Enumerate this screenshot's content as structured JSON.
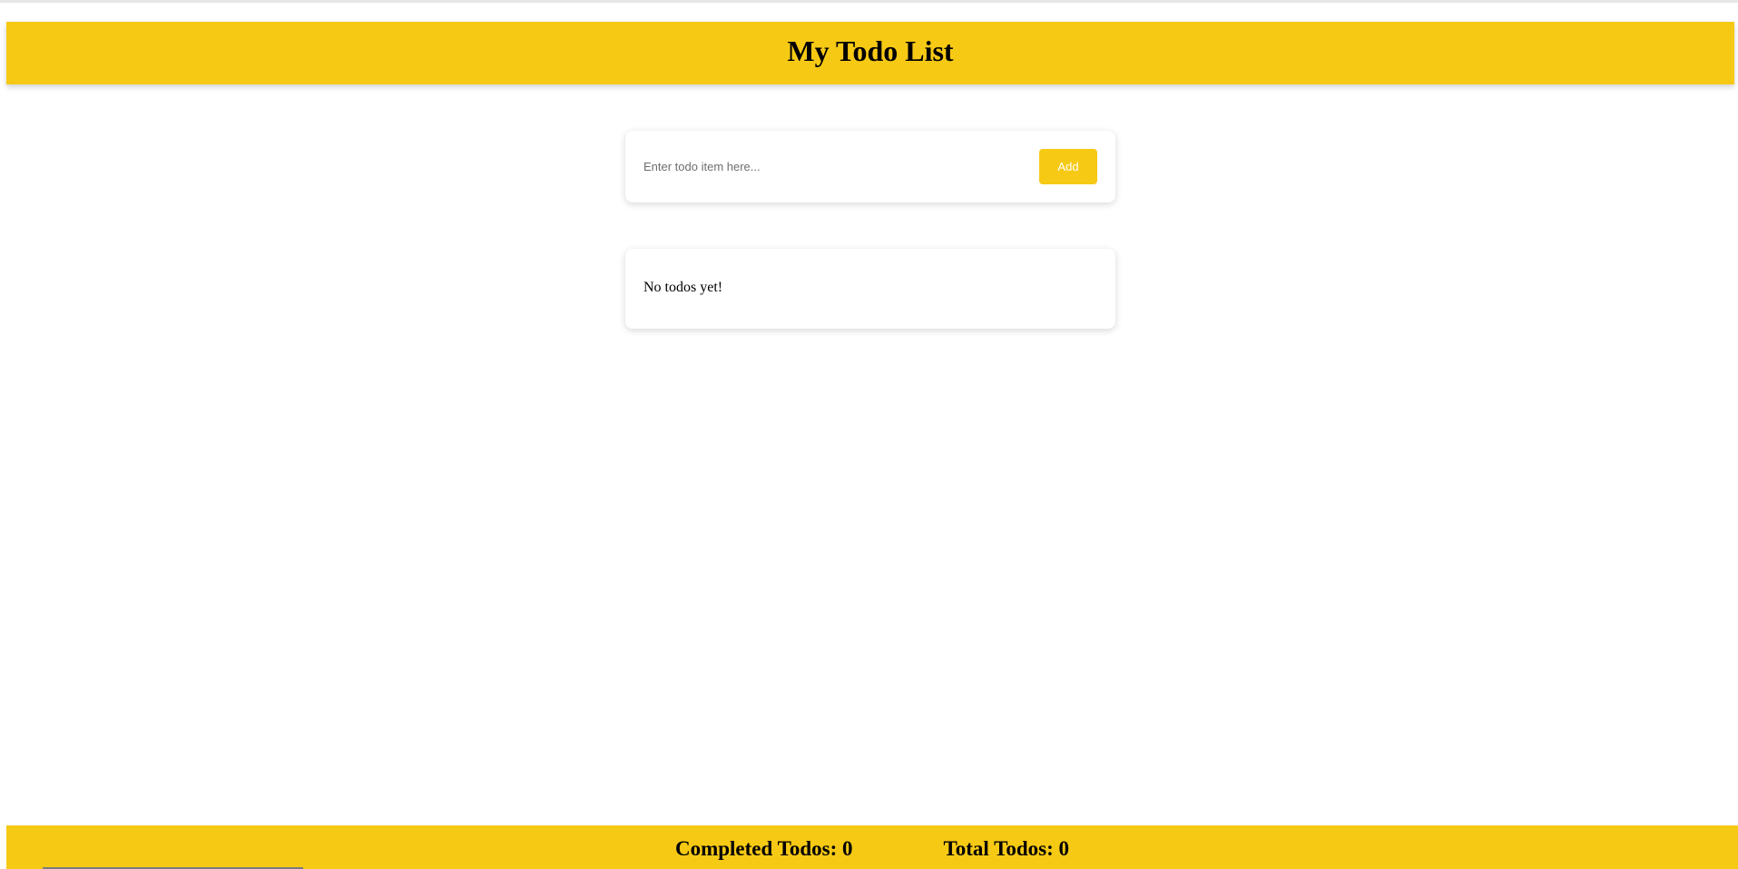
{
  "header": {
    "title": "My Todo List"
  },
  "add_form": {
    "placeholder": "Enter todo item here...",
    "value": "",
    "add_label": "Add"
  },
  "todo_list": {
    "items": [],
    "empty_message": "No todos yet!"
  },
  "footer": {
    "completed_label": "Completed Todos: 0",
    "total_label": "Total Todos: 0"
  },
  "colors": {
    "accent": "#f6c915",
    "background": "#ffffff"
  }
}
